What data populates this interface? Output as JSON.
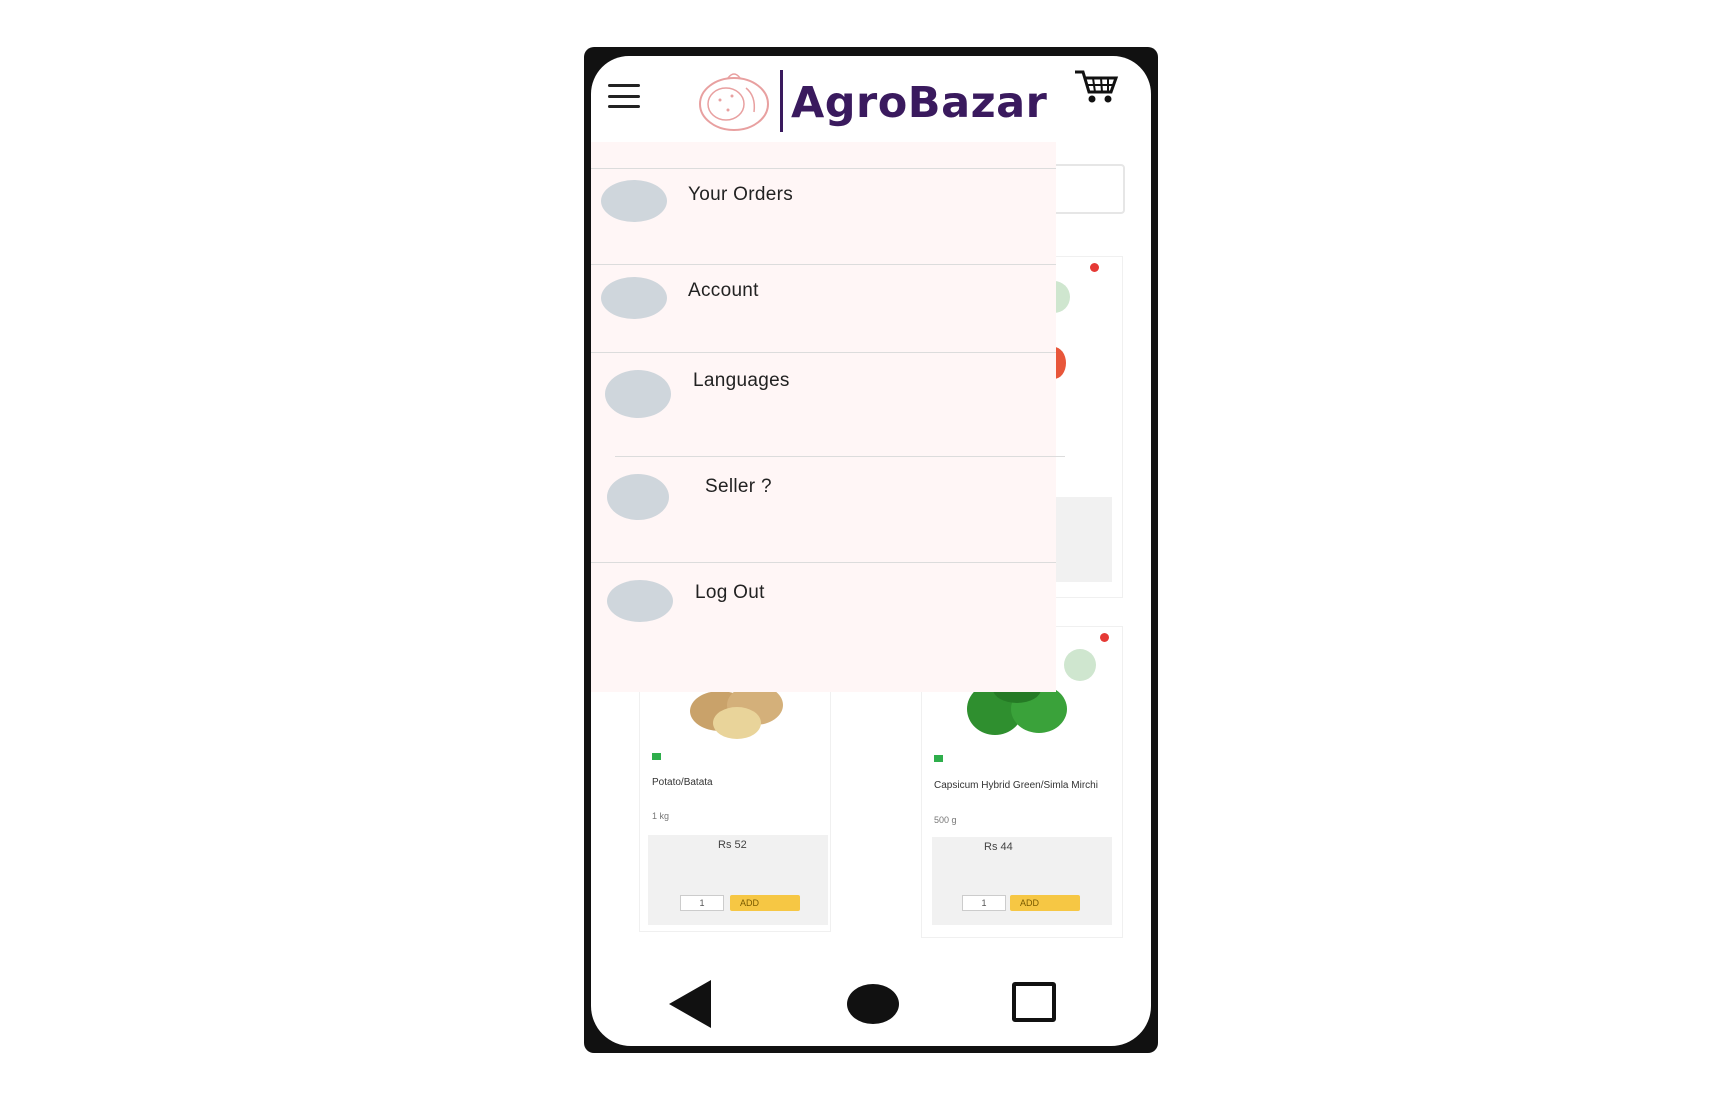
{
  "app": {
    "name": "AgroBazar"
  },
  "drawer": {
    "items": [
      {
        "label": "Your Orders"
      },
      {
        "label": "Account"
      },
      {
        "label": "Languages"
      },
      {
        "label": "Seller ?"
      },
      {
        "label": "Log Out"
      }
    ]
  },
  "products": [
    {
      "name": "Potato/Batata",
      "weight": "1 kg",
      "price": "Rs 52",
      "qty": "1",
      "add": "ADD"
    },
    {
      "name": "Capsicum Hybrid Green/Simla Mirchi",
      "weight": "500 g",
      "price": "Rs 44",
      "qty": "1",
      "add": "ADD"
    }
  ],
  "colors": {
    "brand": "#3a1a5e",
    "drawer_bg": "#fff6f6",
    "add_button": "#f6c744"
  },
  "icons": [
    "hamburger-icon",
    "cart-icon",
    "back-icon",
    "home-icon",
    "recent-apps-icon"
  ]
}
